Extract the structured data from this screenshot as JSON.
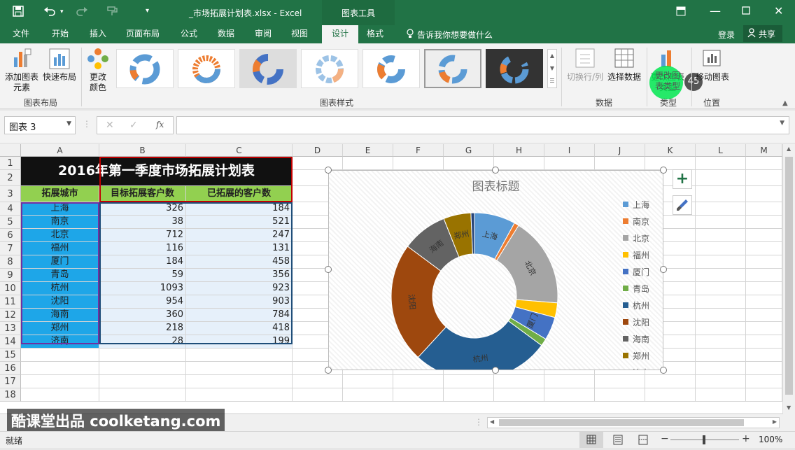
{
  "titlebar": {
    "filename": "_市场拓展计划表.xlsx - Excel",
    "context_tab": "图表工具",
    "save_icon": "save-icon",
    "undo_icon": "undo-icon"
  },
  "tabs": [
    "文件",
    "开始",
    "插入",
    "页面布局",
    "公式",
    "数据",
    "审阅",
    "视图",
    "设计",
    "格式"
  ],
  "tellme": "告诉我你想要做什么",
  "login": "登录",
  "share": "共享",
  "ribbon": {
    "add_element": "添加图表元素",
    "quick_layout": "快速布局",
    "change_color": "更改颜色",
    "group_layout": "图表布局",
    "group_styles": "图表样式",
    "switch_rowcol": "切换行/列",
    "select_data": "选择数据",
    "group_data": "数据",
    "change_type": "更改图表类型",
    "group_type": "类型",
    "move_chart": "移动图表",
    "group_location": "位置",
    "tooltip_badge": "45"
  },
  "namebox": "图表 3",
  "fx": "fx",
  "columns": [
    "A",
    "B",
    "C",
    "D",
    "E",
    "F",
    "G",
    "H",
    "I",
    "J",
    "K",
    "L",
    "M"
  ],
  "rows": [
    "1",
    "2",
    "3",
    "4",
    "5",
    "6",
    "7",
    "8",
    "9",
    "10",
    "11",
    "12",
    "13",
    "14",
    "15",
    "16",
    "17",
    "18"
  ],
  "table": {
    "title": "2016年第一季度市场拓展计划表",
    "headers": [
      "拓展城市",
      "目标拓展客户数",
      "已拓展的客户数"
    ],
    "data": [
      [
        "上海",
        "326",
        "184"
      ],
      [
        "南京",
        "38",
        "521"
      ],
      [
        "北京",
        "712",
        "247"
      ],
      [
        "福州",
        "116",
        "131"
      ],
      [
        "厦门",
        "184",
        "458"
      ],
      [
        "青岛",
        "59",
        "356"
      ],
      [
        "杭州",
        "1093",
        "923"
      ],
      [
        "沈阳",
        "954",
        "903"
      ],
      [
        "海南",
        "360",
        "784"
      ],
      [
        "郑州",
        "218",
        "418"
      ],
      [
        "济南",
        "28",
        "199"
      ]
    ]
  },
  "chart_data": {
    "type": "pie",
    "variant": "doughnut",
    "title": "图表标题",
    "categories": [
      "上海",
      "南京",
      "北京",
      "福州",
      "厦门",
      "青岛",
      "杭州",
      "沈阳",
      "海南",
      "郑州",
      "济南"
    ],
    "series": [
      {
        "values": [
          326,
          38,
          712,
          116,
          184,
          59,
          1093,
          954,
          360,
          218,
          28
        ]
      }
    ],
    "colors": [
      "#5b9bd5",
      "#ed7d31",
      "#a5a5a5",
      "#ffc000",
      "#4472c4",
      "#70ad47",
      "#255e91",
      "#9e480e",
      "#636363",
      "#997300",
      "#264478"
    ],
    "legend": "right",
    "legend_visible": [
      "上海",
      "南京",
      "北京",
      "福州",
      "厦门",
      "青岛",
      "杭州",
      "沈阳",
      "海南",
      "郑州"
    ]
  },
  "sheet": {
    "watermark": "酷课堂出品 coolketang.com"
  },
  "status": {
    "ready": "就绪",
    "zoom": "100%"
  }
}
